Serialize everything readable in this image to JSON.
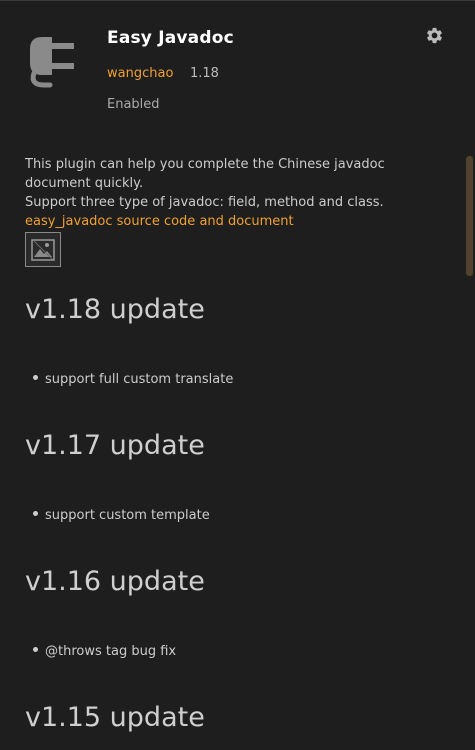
{
  "plugin": {
    "name": "Easy Javadoc",
    "author": "wangchao",
    "version": "1.18",
    "status": "Enabled"
  },
  "icons": {
    "plugin": "plug-icon",
    "settings": "gear-icon",
    "broken_image": "broken-image-icon"
  },
  "description": {
    "line1": "This plugin can help you complete the Chinese javadoc document quickly.",
    "line2": "Support three type of javadoc: field, method and class.",
    "link_text": "easy_javadoc source code and document"
  },
  "releases": [
    {
      "title": "v1.18 update",
      "item": "support full custom translate"
    },
    {
      "title": "v1.17 update",
      "item": "support custom template"
    },
    {
      "title": "v1.16 update",
      "item": "@throws tag bug fix"
    },
    {
      "title": "v1.15 update",
      "item": ""
    }
  ],
  "colors": {
    "background": "#1e1e1e",
    "accent": "#f0a030",
    "title": "#ffffff",
    "text": "#cccccc"
  }
}
